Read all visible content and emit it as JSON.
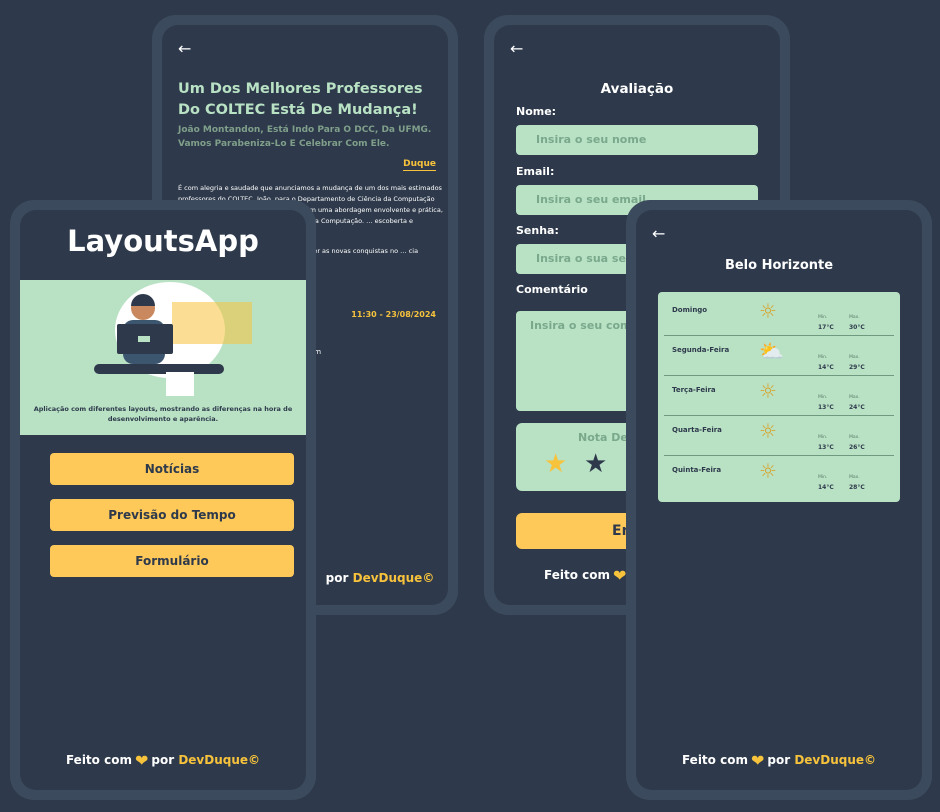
{
  "news": {
    "title": "Um Dos Melhores Professores Do COLTEC Está De Mudança!",
    "subtitle": "João Montandon, Está Indo Para O DCC,  Da UFMG. Vamos Parabeniza-Lo E Celebrar Com Ele.",
    "author": "Duque",
    "body_p1": "É com alegria e saudade que anunciamos a mudança de um dos mais estimados professores do COLTEC, João, para o Departamento de Ciência da Computação (DCC) da UFMG. João inovou o ensino com uma abordagem envolvente e prática, e … cia acadêmica foi crucial na … esso na Computação. … escoberta e crescimento.",
    "body_p2": "… te seu compromisso e paixão … para ver as novas conquistas no … cia continuará a se espalhar.",
    "date": "11:30 - 23/08/2024",
    "extra": "om"
  },
  "form": {
    "title": "Avaliação",
    "name_label": "Nome:",
    "name_placeholder": "Insira o seu nome",
    "email_label": "Email:",
    "email_placeholder": "Insira o seu email",
    "password_label": "Senha:",
    "password_placeholder": "Insira o sua senha",
    "comment_label": "Comentário",
    "comment_placeholder": "Insira o seu comentário",
    "rating_label": "Nota De Avaliação",
    "rating": 1,
    "submit": "Enviar"
  },
  "weather": {
    "city": "Belo Horizonte",
    "min_label": "Min.",
    "max_label": "Max.",
    "days": [
      {
        "day": "Domingo",
        "icon": "sun-icon",
        "min": "17°C",
        "max": "30°C"
      },
      {
        "day": "Segunda-Feira",
        "icon": "partly-cloudy-icon",
        "min": "14°C",
        "max": "29°C"
      },
      {
        "day": "Terça-Feira",
        "icon": "sun-icon",
        "min": "13°C",
        "max": "24°C"
      },
      {
        "day": "Quarta-Feira",
        "icon": "sun-icon",
        "min": "13°C",
        "max": "26°C"
      },
      {
        "day": "Quinta-Feira",
        "icon": "sun-icon",
        "min": "14°C",
        "max": "28°C"
      }
    ]
  },
  "home": {
    "app_title": "LayoutsApp",
    "caption": "Aplicação com diferentes layouts, mostrando as diferenças na hora de desenvolvimento e aparência.",
    "buttons": [
      "Notícias",
      "Previsão do Tempo",
      "Formulário"
    ]
  },
  "footer": {
    "made_with": "Feito com",
    "by": "por",
    "brand": "DevDuque©"
  },
  "colors": {
    "background": "#2e3a4b",
    "frame": "#3b4a5d",
    "mint": "#b9e2c5",
    "accent": "#ffc95a",
    "brand": "#f7c23c"
  }
}
